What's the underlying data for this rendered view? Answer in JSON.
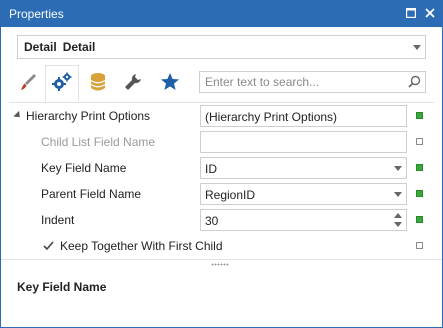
{
  "window": {
    "title": "Properties",
    "accent": "#2b6cb5"
  },
  "selector": {
    "name": "Detail",
    "type": "Detail"
  },
  "toolbar": {
    "tools": [
      {
        "icon": "brush-icon",
        "active": false
      },
      {
        "icon": "gears-icon",
        "active": true
      },
      {
        "icon": "database-icon",
        "active": false
      },
      {
        "icon": "wrench-icon",
        "active": false
      },
      {
        "icon": "star-icon",
        "active": false
      }
    ],
    "search_placeholder": "Enter text to search..."
  },
  "grid": {
    "rows": [
      {
        "label": "Hierarchy Print Options",
        "value": "(Hierarchy Print Options)",
        "editor": "text",
        "disabled": false,
        "marker": "filled",
        "expander": true
      },
      {
        "label": "Child List Field Name",
        "value": "",
        "editor": "text",
        "disabled": true,
        "marker": "empty"
      },
      {
        "label": "Key Field Name",
        "value": "ID",
        "editor": "dropdown",
        "disabled": false,
        "marker": "filled"
      },
      {
        "label": "Parent Field Name",
        "value": "RegionID",
        "editor": "dropdown",
        "disabled": false,
        "marker": "filled"
      },
      {
        "label": "Indent",
        "value": "30",
        "editor": "spin",
        "disabled": false,
        "marker": "filled"
      },
      {
        "label": "Keep Together With First Child",
        "value": "",
        "editor": "checkbox",
        "checked": true,
        "marker": "empty"
      }
    ]
  },
  "description": {
    "title": "Key Field Name"
  },
  "colors": {
    "marker_green": "#3aa83a",
    "icon_blue": "#1f5fa8",
    "icon_red": "#c0392b",
    "icon_gold": "#d8a43a"
  }
}
